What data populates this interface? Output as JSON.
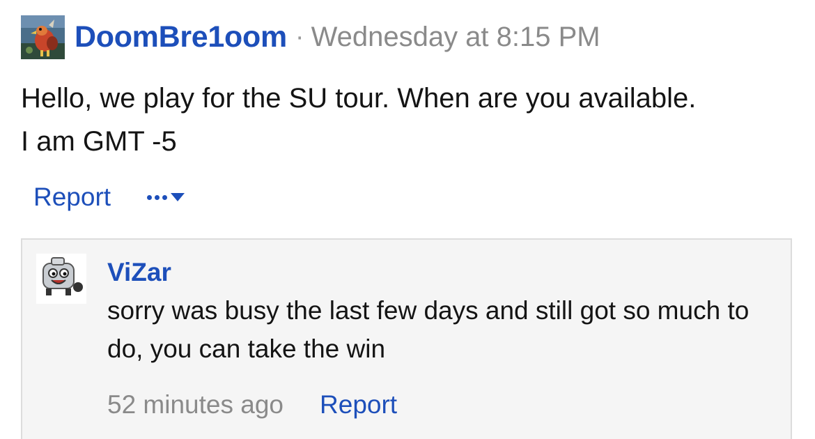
{
  "post": {
    "author": "DoomBre1oom",
    "separator": "·",
    "date": "Wednesday at 8:15 PM",
    "body_line1": "Hello, we play for the SU tour. When are you available.",
    "body_line2": "I am GMT -5",
    "report_label": "Report",
    "more_icon": "more-dots-dropdown-icon"
  },
  "reply": {
    "author": "ViZar",
    "body": "sorry was busy the last few days and still got so much to do, you can take the win",
    "time": "52 minutes ago",
    "report_label": "Report"
  },
  "colors": {
    "link": "#1d4fba",
    "muted": "#8a8a8a",
    "text": "#141414",
    "reply_bg": "#f5f5f5",
    "reply_border": "#dcdcdc"
  }
}
